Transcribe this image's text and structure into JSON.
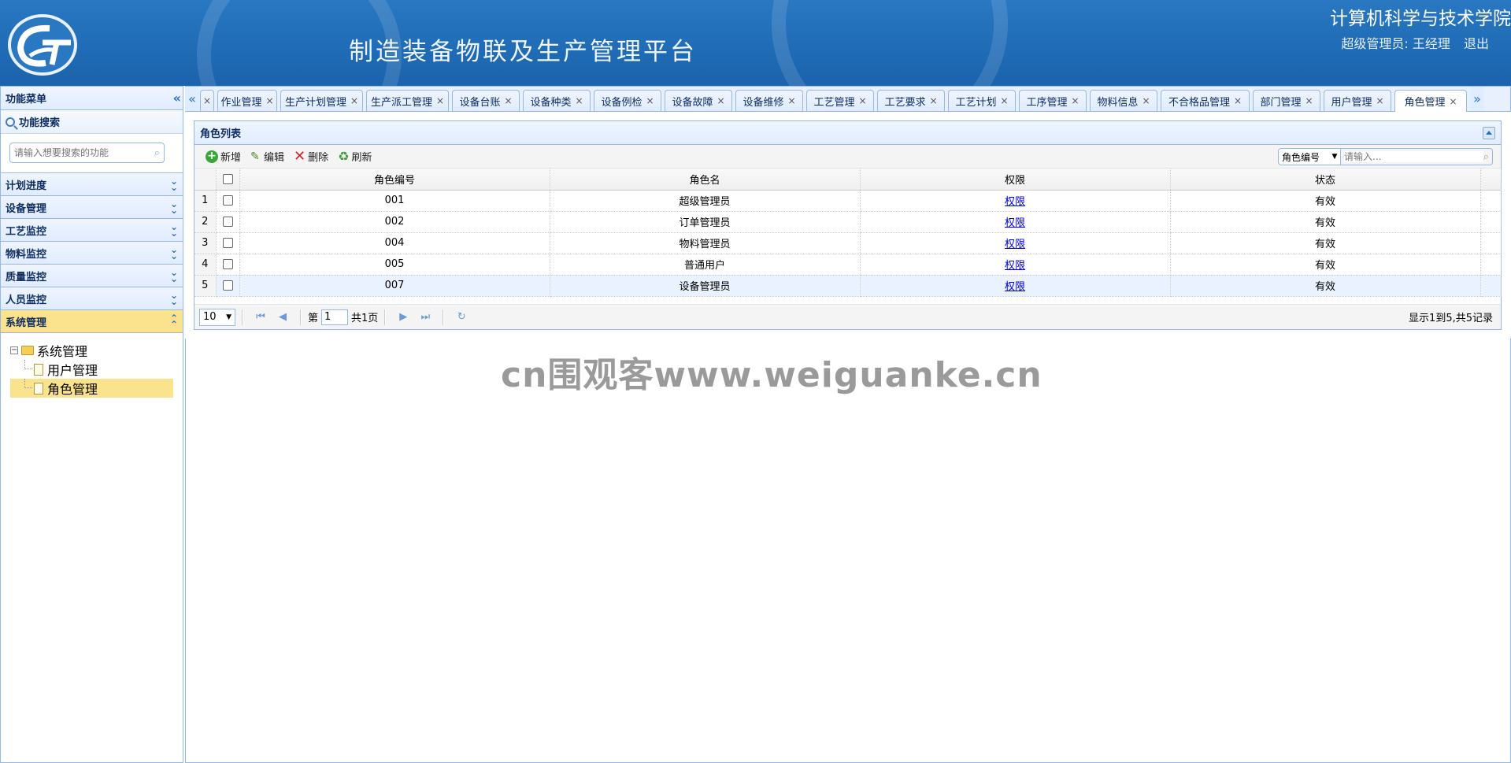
{
  "header": {
    "app_title": "制造装备物联及生产管理平台",
    "school": "计算机科学与技术学院",
    "user": "超级管理员: 王经理",
    "logout": "退出"
  },
  "sidebar": {
    "title": "功能菜单",
    "search_title": "功能搜索",
    "search_placeholder": "请输入想要搜索的功能",
    "sections": [
      "计划进度",
      "设备管理",
      "工艺监控",
      "物料监控",
      "质量监控",
      "人员监控"
    ],
    "active_section": "系统管理",
    "tree": {
      "root": "系统管理",
      "children": [
        "用户管理",
        "角色管理"
      ]
    }
  },
  "tabs": [
    "作业管理",
    "生产计划管理",
    "生产派工管理",
    "设备台账",
    "设备种类",
    "设备例检",
    "设备故障",
    "设备维修",
    "工艺管理",
    "工艺要求",
    "工艺计划",
    "工序管理",
    "物料信息",
    "不合格品管理",
    "部门管理",
    "用户管理",
    "角色管理"
  ],
  "panel": {
    "title": "角色列表",
    "toolbar": {
      "add": "新增",
      "edit": "编辑",
      "delete": "删除",
      "refresh": "刷新"
    },
    "search_field": "角色编号",
    "search_placeholder": "请输入..."
  },
  "grid": {
    "columns": [
      "角色编号",
      "角色名",
      "权限",
      "状态"
    ],
    "rows": [
      {
        "n": "1",
        "code": "001",
        "name": "超级管理员",
        "perm": "权限",
        "status": "有效"
      },
      {
        "n": "2",
        "code": "002",
        "name": "订单管理员",
        "perm": "权限",
        "status": "有效"
      },
      {
        "n": "3",
        "code": "004",
        "name": "物料管理员",
        "perm": "权限",
        "status": "有效"
      },
      {
        "n": "4",
        "code": "005",
        "name": "普通用户",
        "perm": "权限",
        "status": "有效"
      },
      {
        "n": "5",
        "code": "007",
        "name": "设备管理员",
        "perm": "权限",
        "status": "有效"
      }
    ]
  },
  "pager": {
    "page_size": "10",
    "page_prefix": "第",
    "page_value": "1",
    "total_pages": "共1页",
    "info": "显示1到5,共5记录"
  },
  "watermark": "cn围观客www.weiguanke.cn",
  "colors": {
    "header": "#1f6bb5",
    "active": "#fbe28d",
    "border": "#95b8e7"
  }
}
